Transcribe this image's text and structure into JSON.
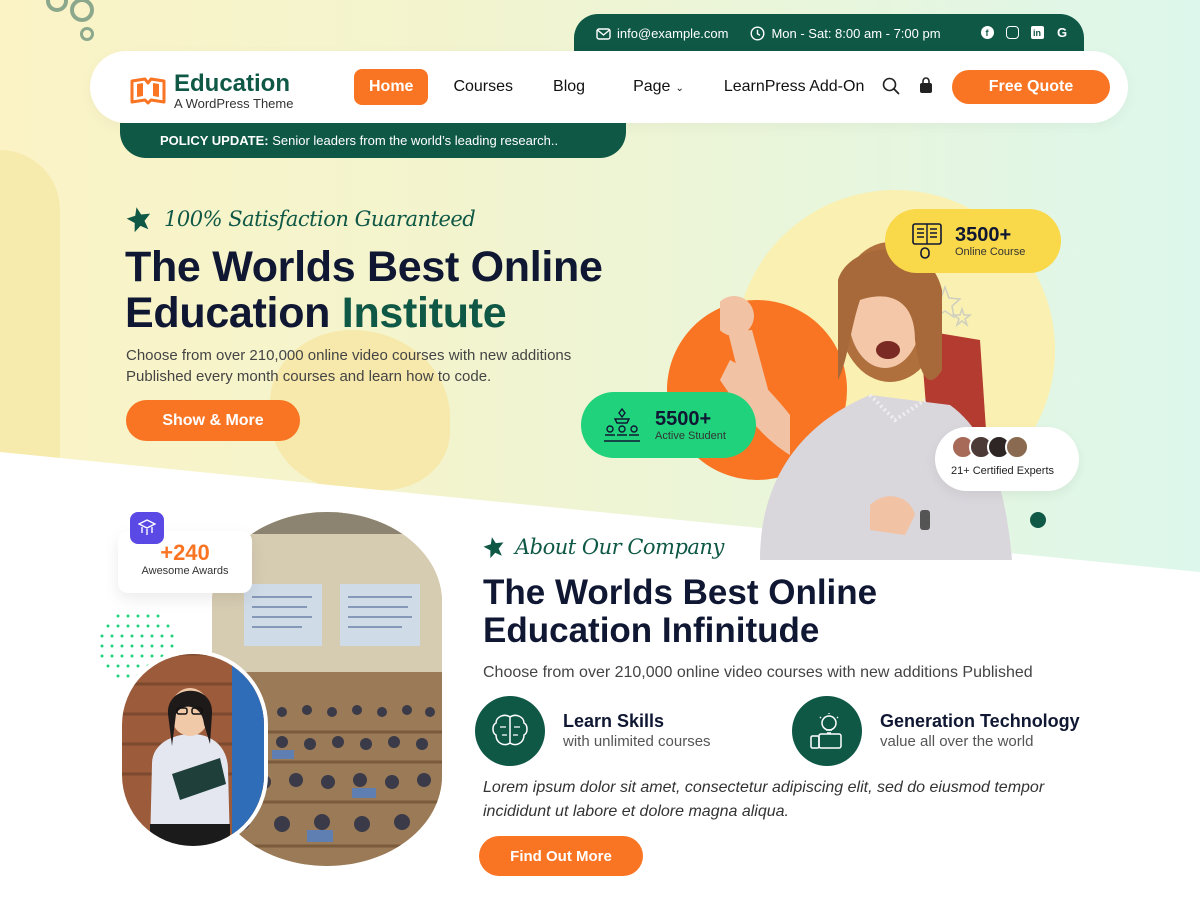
{
  "topbar": {
    "email": "info@example.com",
    "hours": "Mon - Sat: 8:00 am - 7:00 pm",
    "socials": [
      "facebook-icon",
      "instagram-icon",
      "linkedin-icon",
      "google-icon"
    ]
  },
  "brand": {
    "title": "Education",
    "subtitle": "A WordPress Theme"
  },
  "nav": {
    "items": [
      {
        "label": "Home",
        "active": true
      },
      {
        "label": "Courses"
      },
      {
        "label": "Blog"
      },
      {
        "label": "Page",
        "has_dropdown": true
      },
      {
        "label": "LearnPress Add-On"
      }
    ],
    "quote_label": "Free Quote"
  },
  "policy": {
    "label": "POLICY UPDATE:",
    "text": " Senior leaders from the world’s leading research.."
  },
  "hero": {
    "tagline": "100% Satisfaction Guaranteed",
    "title_line1": "The Worlds Best Online",
    "title_line2_plain": "Education ",
    "title_line2_accent": "Institute",
    "description": "Choose from over 210,000 online video courses with new additions Published every month courses and learn how to code.",
    "button": "Show & More",
    "stat_courses": {
      "value": "3500+",
      "label": "Online Course"
    },
    "stat_students": {
      "value": "5500+",
      "label": "Active Student"
    },
    "experts": "21+ Certified Experts"
  },
  "about": {
    "awards": {
      "value": "+240",
      "label": "Awesome Awards"
    },
    "tagline": "About Our Company",
    "title_line1": "The Worlds Best Online",
    "title_line2": "Education Infinitude",
    "description": "Choose from over 210,000 online video courses with new additions Published",
    "features": [
      {
        "title": "Learn Skills",
        "sub": "with unlimited courses"
      },
      {
        "title": "Generation Technology",
        "sub": "value all over the world"
      }
    ],
    "lorem": "Lorem ipsum dolor sit amet, consectetur adipiscing elit, sed do eiusmod tempor incididunt ut labore et dolore magna aliqua.",
    "button": "Find Out More"
  },
  "colors": {
    "brand_green": "#0f5846",
    "accent_orange": "#f97423",
    "stat_yellow": "#f9d849",
    "stat_green": "#21d27c"
  }
}
